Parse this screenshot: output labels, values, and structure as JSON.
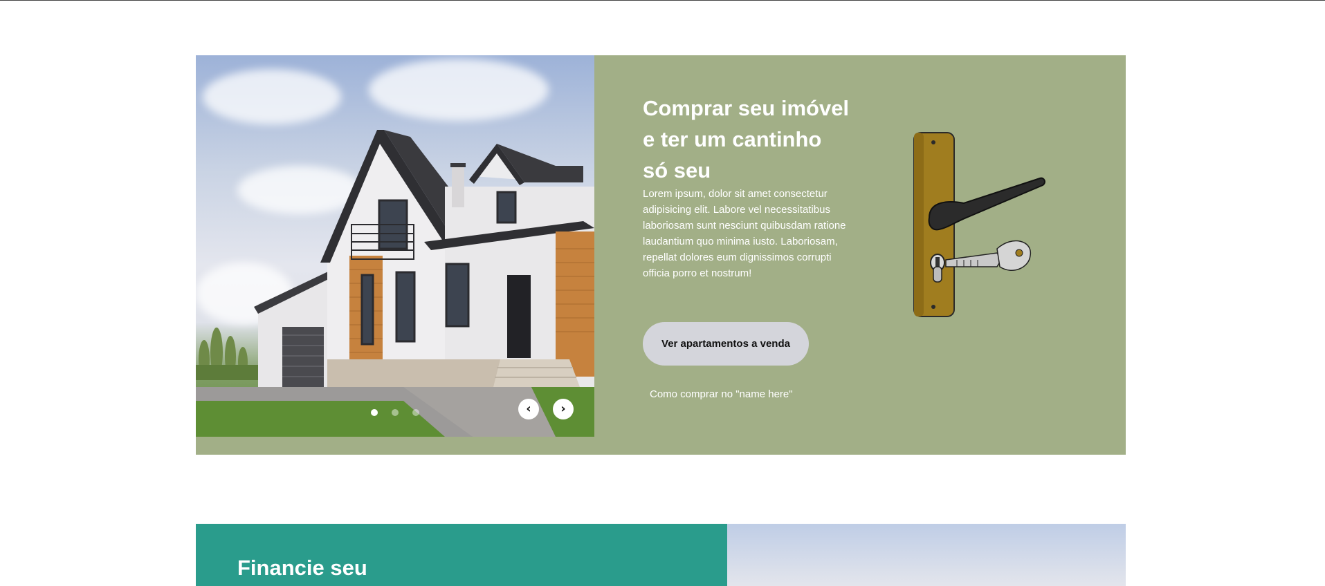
{
  "hero": {
    "title": "Comprar seu imóvel e ter um cantinho só seu",
    "body": "Lorem ipsum, dolor sit amet consectetur adipisicing elit. Labore vel necessitatibus laboriosam sunt nesciunt quibusdam ratione laudantium quo minima iusto. Laboriosam, repellat dolores eum dignissimos corrupti officia porro et nostrum!",
    "cta_label": "Ver apartamentos a venda",
    "secondary_link": "Como comprar no \"name here\"",
    "background_color": "#a2af87",
    "image_icon": "house-photo",
    "art_icon": "door-handle-key-icon"
  },
  "slider": {
    "dots": [
      {
        "active": true
      },
      {
        "active": false
      },
      {
        "active": false
      }
    ],
    "prev_icon": "chevron-left-icon",
    "prev_label": "‹",
    "next_icon": "chevron-right-icon",
    "next_label": "›"
  },
  "finance": {
    "title": "Financie seu",
    "background_color": "#2a9c8c"
  }
}
